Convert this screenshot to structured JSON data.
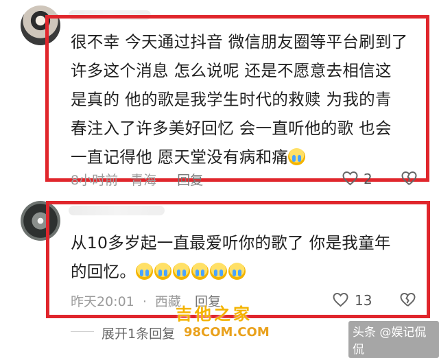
{
  "comments": [
    {
      "text_lines": [
        "很不幸 今天通过抖音 微信朋友圈等平台刷到了",
        "许多这个消息  怎么说呢 还是不愿意去相信这",
        "是真的  他的歌是我学生时代的救赎  为我的青",
        "春注入了许多美好回忆  会一直听他的歌 也会",
        "一直记得他  愿天堂没有病和痛"
      ],
      "time": "8小时前",
      "location": "青海",
      "reply_label": "回复",
      "likes": "2"
    },
    {
      "text_lines": [
        "从10多岁起一直最爱听你的歌了     你是我童年",
        "的回忆。"
      ],
      "time": "昨天20:01",
      "separator": "·",
      "location": "西藏",
      "reply_label": "回复",
      "likes": "13"
    }
  ],
  "expand_label": "展开1条回复",
  "watermark": {
    "text": "吉他之家",
    "url": "98COM.COM"
  },
  "brand": "头条 @娱记侃侃",
  "colors": {
    "highlight": "#e0262c",
    "text": "#1f1f1f",
    "meta": "#9b9b9b"
  },
  "icons": [
    "cry-emoji-icon",
    "heart-icon",
    "broken-heart-icon"
  ]
}
